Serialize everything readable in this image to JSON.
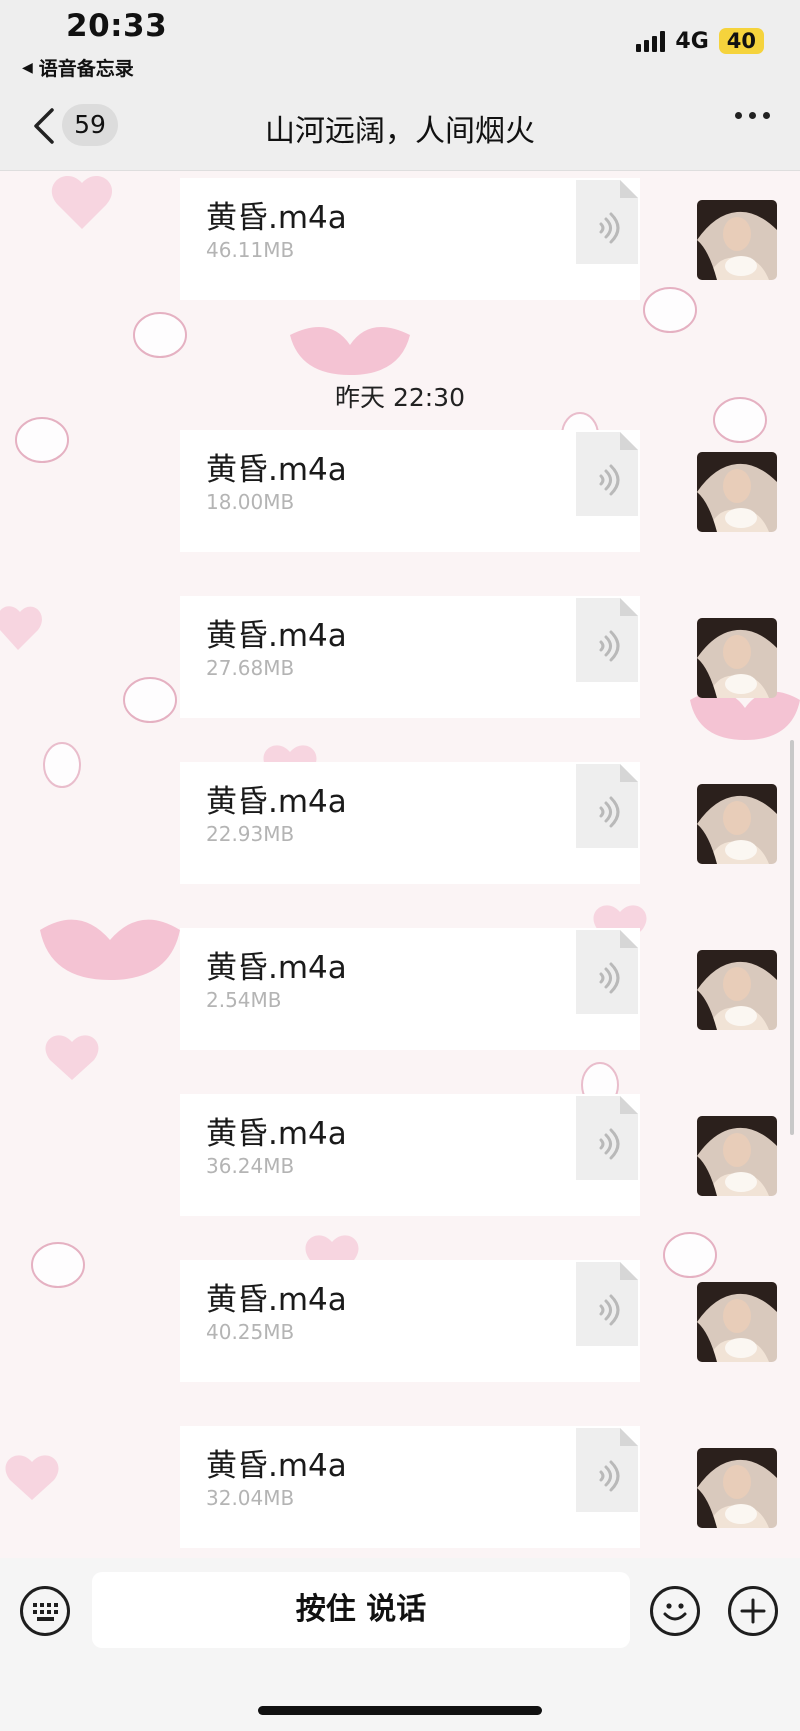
{
  "status_bar": {
    "time": "20:33",
    "back_app": "语音备忘录",
    "network": "4G",
    "battery": "40"
  },
  "nav": {
    "unread_count": "59",
    "title": "山河远阔，人间烟火"
  },
  "timestamp": "昨天 22:30",
  "messages": [
    {
      "file_name": "黄昏.m4a",
      "file_size": "46.11MB"
    },
    {
      "file_name": "黄昏.m4a",
      "file_size": "18.00MB"
    },
    {
      "file_name": "黄昏.m4a",
      "file_size": "27.68MB"
    },
    {
      "file_name": "黄昏.m4a",
      "file_size": "22.93MB"
    },
    {
      "file_name": "黄昏.m4a",
      "file_size": "2.54MB"
    },
    {
      "file_name": "黄昏.m4a",
      "file_size": "36.24MB"
    },
    {
      "file_name": "黄昏.m4a",
      "file_size": "40.25MB"
    },
    {
      "file_name": "黄昏.m4a",
      "file_size": "32.04MB"
    }
  ],
  "input_bar": {
    "hold_to_talk": "按住 说话"
  },
  "colors": {
    "bar_bg": "#eeeeee",
    "battery_fill": "#f5d33c",
    "wallpaper_pink": "#f4c6d6"
  },
  "icons": [
    "keyboard-icon",
    "emoji-icon",
    "plus-icon",
    "audio-file-icon",
    "chevron-left-icon",
    "more-icon",
    "signal-icon"
  ]
}
